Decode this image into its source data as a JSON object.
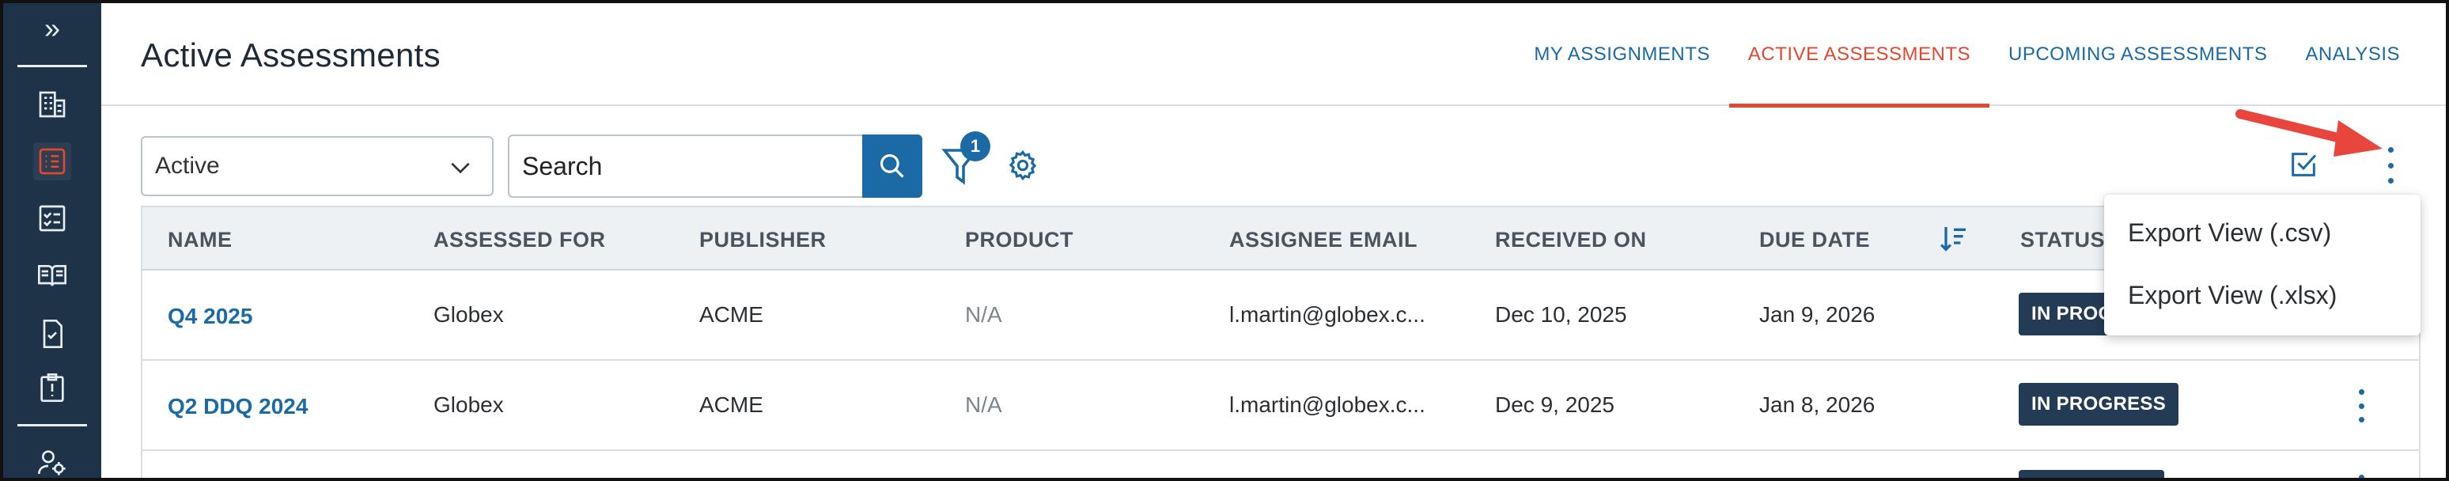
{
  "page": {
    "title": "Active Assessments"
  },
  "tabs": [
    {
      "label": "MY ASSIGNMENTS",
      "active": false
    },
    {
      "label": "ACTIVE ASSESSMENTS",
      "active": true
    },
    {
      "label": "UPCOMING ASSESSMENTS",
      "active": false
    },
    {
      "label": "ANALYSIS",
      "active": false
    }
  ],
  "sidebar": {
    "expand_glyph": "»",
    "items": [
      {
        "icon": "building-icon"
      },
      {
        "icon": "checklist-icon",
        "active": true
      },
      {
        "icon": "clipboard-check-icon"
      },
      {
        "icon": "book-icon"
      },
      {
        "icon": "document-check-icon"
      },
      {
        "icon": "alert-clipboard-icon"
      },
      {
        "icon": "user-settings-icon"
      }
    ]
  },
  "toolbar": {
    "status_filter_value": "Active",
    "search_placeholder": "Search",
    "filter_count": "1"
  },
  "table": {
    "columns": [
      "NAME",
      "ASSESSED FOR",
      "PUBLISHER",
      "PRODUCT",
      "ASSIGNEE EMAIL",
      "RECEIVED ON",
      "DUE DATE",
      "STATUS"
    ],
    "rows": [
      {
        "name": "Q4 2025",
        "assessed_for": "Globex",
        "publisher": "ACME",
        "product": "N/A",
        "assignee_email": "l.martin@globex.c...",
        "received_on": "Dec 10, 2025",
        "due_date": "Jan 9, 2026",
        "status": "IN PROGRESS"
      },
      {
        "name": "Q2 DDQ 2024",
        "assessed_for": "Globex",
        "publisher": "ACME",
        "product": "N/A",
        "assignee_email": "l.martin@globex.c...",
        "received_on": "Dec 9, 2025",
        "due_date": "Jan 8, 2026",
        "status": "IN PROGRESS"
      }
    ]
  },
  "export_menu": {
    "items": [
      "Export View (.csv)",
      "Export View (.xlsx)"
    ]
  },
  "colors": {
    "sidebar_bg": "#1f3348",
    "accent_blue": "#1b6aa5",
    "active_tab": "#e2472f",
    "status_badge": "#243b55",
    "annotation_arrow": "#e8453c"
  }
}
